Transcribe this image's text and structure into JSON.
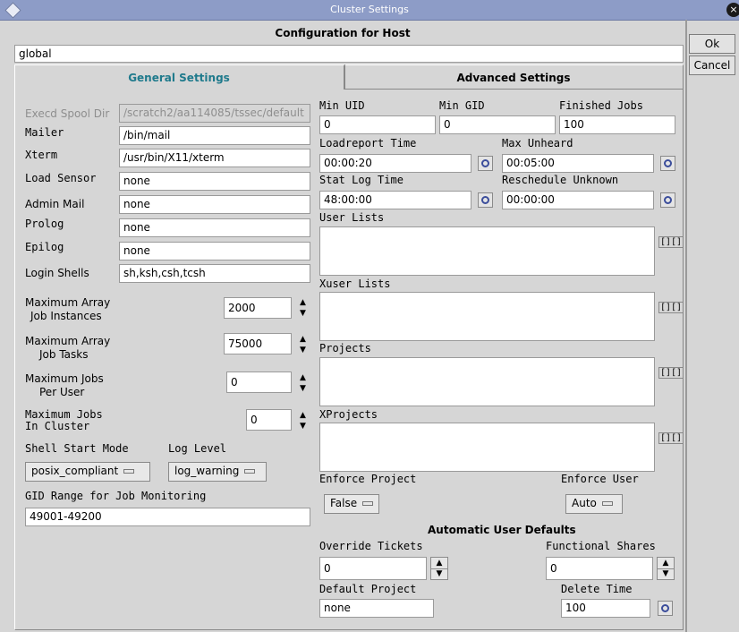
{
  "window": {
    "title": "Cluster Settings",
    "close_glyph": "×"
  },
  "header": "Configuration for Host",
  "host": "global",
  "sidebar": {
    "ok": "Ok",
    "cancel": "Cancel"
  },
  "tabs": {
    "general": "General Settings",
    "advanced": "Advanced Settings"
  },
  "left": {
    "execd_label": "Execd Spool Dir",
    "execd_value": "/scratch2/aa114085/tssec/default",
    "mailer_label": "Mailer",
    "mailer_value": "/bin/mail",
    "xterm_label": "Xterm",
    "xterm_value": "/usr/bin/X11/xterm",
    "load_sensor_label": "Load Sensor",
    "load_sensor_value": "none",
    "admin_mail_label": "Admin Mail",
    "admin_mail_value": "none",
    "prolog_label": "Prolog",
    "prolog_value": "none",
    "epilog_label": "Epilog",
    "epilog_value": "none",
    "login_shells_label": "Login Shells",
    "login_shells_value": "sh,ksh,csh,tcsh",
    "max_array_instances_l1": "Maximum Array",
    "max_array_instances_l2": "Job Instances",
    "max_array_instances_value": "2000",
    "max_array_tasks_l1": "Maximum Array",
    "max_array_tasks_l2": "Job Tasks",
    "max_array_tasks_value": "75000",
    "max_jobs_user_l1": "Maximum Jobs",
    "max_jobs_user_l2": "Per User",
    "max_jobs_user_value": "0",
    "max_jobs_cluster_l1": "Maximum Jobs",
    "max_jobs_cluster_l2": "In Cluster",
    "max_jobs_cluster_value": "0",
    "shell_start_label": "Shell Start Mode",
    "log_level_label": "Log Level",
    "shell_start_value": "posix_compliant",
    "log_level_value": "log_warning",
    "gid_label": "GID Range for Job Monitoring",
    "gid_value": "49001-49200"
  },
  "right": {
    "min_uid_label": "Min UID",
    "min_uid_value": "0",
    "min_gid_label": "Min GID",
    "min_gid_value": "0",
    "finished_jobs_label": "Finished Jobs",
    "finished_jobs_value": "100",
    "loadreport_label": "Loadreport Time",
    "loadreport_value": "00:00:20",
    "max_unheard_label": "Max Unheard",
    "max_unheard_value": "00:05:00",
    "stat_log_label": "Stat Log Time",
    "stat_log_value": "48:00:00",
    "reschedule_label": "Reschedule Unknown",
    "reschedule_value": "00:00:00",
    "user_lists_label": "User Lists",
    "xuser_lists_label": "Xuser Lists",
    "projects_label": "Projects",
    "xprojects_label": "XProjects",
    "enforce_project_label": "Enforce Project",
    "enforce_project_value": "False",
    "enforce_user_label": "Enforce User",
    "enforce_user_value": "Auto",
    "auto_defaults_label": "Automatic User Defaults",
    "override_tickets_label": "Override Tickets",
    "override_tickets_value": "0",
    "functional_shares_label": "Functional Shares",
    "functional_shares_value": "0",
    "default_project_label": "Default Project",
    "default_project_value": "none",
    "delete_time_label": "Delete Time",
    "delete_time_value": "100"
  },
  "glyphs": {
    "up": "▲",
    "down": "▼",
    "list_button": "[][]",
    "spin_up": "▲",
    "spin_down": "▼"
  },
  "colors": {
    "titlebar": "#8d9cc7",
    "tab_text": "#1f7a8c",
    "icon_blue": "#3b4d9b"
  }
}
